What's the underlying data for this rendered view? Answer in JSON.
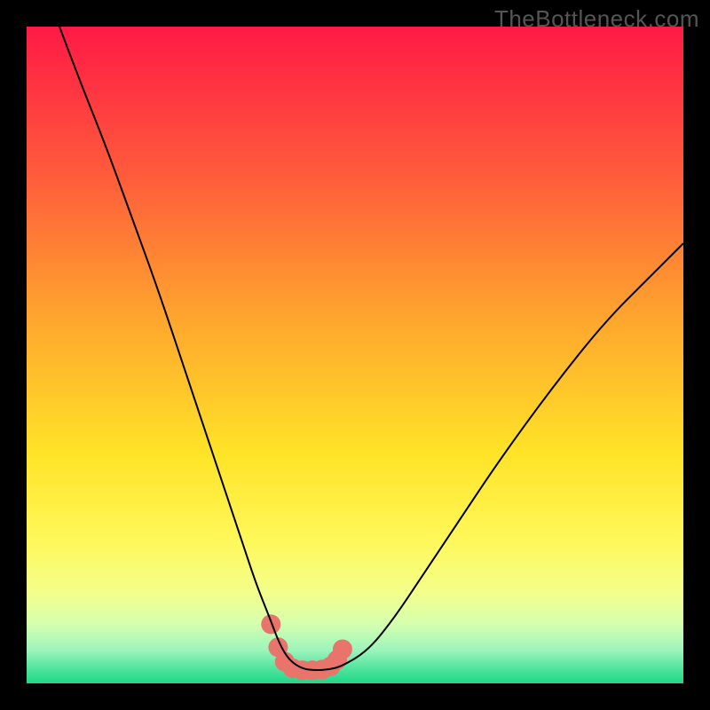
{
  "watermark": "TheBottleneck.com",
  "chart_data": {
    "type": "line",
    "title": "",
    "xlabel": "",
    "ylabel": "",
    "xlim": [
      0,
      100
    ],
    "ylim": [
      0,
      100
    ],
    "background_gradient": {
      "stops": [
        {
          "pct": 0,
          "color": "#ff1a46"
        },
        {
          "pct": 22,
          "color": "#ff5a3c"
        },
        {
          "pct": 45,
          "color": "#ffa82e"
        },
        {
          "pct": 65,
          "color": "#ffe428"
        },
        {
          "pct": 78,
          "color": "#fff85a"
        },
        {
          "pct": 86,
          "color": "#f4ff8a"
        },
        {
          "pct": 91,
          "color": "#d6ffb0"
        },
        {
          "pct": 95,
          "color": "#9bf5bc"
        },
        {
          "pct": 98,
          "color": "#4ae29c"
        },
        {
          "pct": 100,
          "color": "#1fd888"
        }
      ]
    },
    "series": [
      {
        "name": "bottleneck-curve",
        "color": "#000000",
        "stroke_width": 2,
        "x": [
          5,
          8,
          12,
          16,
          20,
          24,
          27,
          30,
          33,
          35,
          37,
          38.5,
          40,
          42,
          44,
          46,
          48,
          52,
          56,
          60,
          66,
          72,
          80,
          88,
          95,
          100
        ],
        "values": [
          100,
          92,
          82,
          71,
          60,
          48,
          39,
          30,
          21,
          15,
          10,
          6,
          3.5,
          2.2,
          2,
          2.1,
          2.6,
          5,
          10,
          16,
          25,
          34,
          45,
          55,
          62,
          67
        ]
      },
      {
        "name": "marker-band",
        "type": "scatter",
        "color": "#e8746c",
        "radius": 11,
        "x": [
          37.2,
          38.3,
          39.3,
          40.5,
          42.0,
          43.5,
          45.0,
          46.3,
          47.3,
          48.1
        ],
        "values": [
          9.0,
          5.5,
          3.3,
          2.3,
          2.0,
          2.0,
          2.1,
          2.6,
          3.6,
          5.2
        ]
      }
    ]
  }
}
